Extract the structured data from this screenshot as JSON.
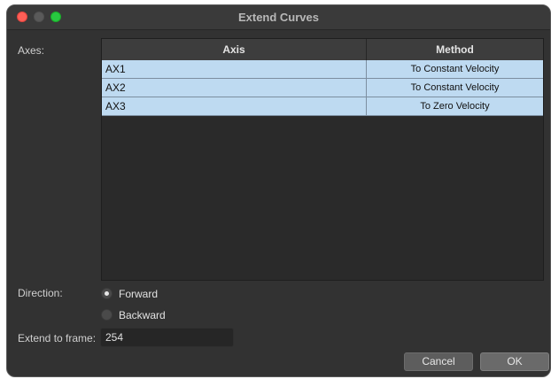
{
  "window": {
    "title": "Extend Curves"
  },
  "axes_label": "Axes:",
  "table": {
    "headers": {
      "axis": "Axis",
      "method": "Method"
    },
    "rows": [
      {
        "axis": "AX1",
        "method": "To Constant Velocity"
      },
      {
        "axis": "AX2",
        "method": "To Constant Velocity"
      },
      {
        "axis": "AX3",
        "method": "To Zero Velocity"
      }
    ]
  },
  "direction": {
    "label": "Direction:",
    "options": [
      {
        "label": "Forward",
        "checked": true
      },
      {
        "label": "Backward",
        "checked": false
      }
    ]
  },
  "extend_to_frame": {
    "label": "Extend to frame:",
    "value": "254"
  },
  "buttons": {
    "cancel": "Cancel",
    "ok": "OK"
  },
  "colors": {
    "window_bg": "#323232",
    "selected_row": "#bedaf1",
    "close": "#fe5f57",
    "zoom": "#28c840"
  }
}
